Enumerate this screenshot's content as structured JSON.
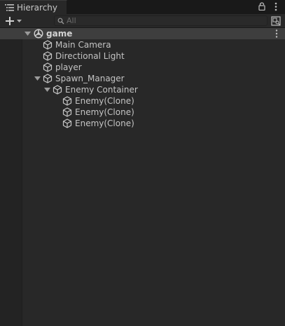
{
  "window": {
    "tab_title": "Hierarchy",
    "icons": {
      "tab": "hierarchy-list-icon",
      "lock": "lock-icon",
      "menu": "kebab-menu-icon"
    }
  },
  "toolbar": {
    "add_icon": "plus-dropdown-icon",
    "search": {
      "placeholder": "All",
      "value": ""
    },
    "scene_visibility_icon": "scene-visibility-icon"
  },
  "scene": {
    "name": "game",
    "expanded": true,
    "icon": "unity-scene-icon",
    "menu_icon": "kebab-menu-icon"
  },
  "hierarchy": [
    {
      "label": "Main Camera",
      "depth": 1,
      "has_children": false
    },
    {
      "label": "Directional Light",
      "depth": 1,
      "has_children": false
    },
    {
      "label": "player",
      "depth": 1,
      "has_children": false
    },
    {
      "label": "Spawn_Manager",
      "depth": 1,
      "has_children": true,
      "expanded": true
    },
    {
      "label": "Enemy Container",
      "depth": 2,
      "has_children": true,
      "expanded": true
    },
    {
      "label": "Enemy(Clone)",
      "depth": 3,
      "has_children": false
    },
    {
      "label": "Enemy(Clone)",
      "depth": 3,
      "has_children": false
    },
    {
      "label": "Enemy(Clone)",
      "depth": 3,
      "has_children": false
    }
  ],
  "colors": {
    "panel_bg": "#282828",
    "tab_strip": "#191919",
    "scene_row_bg": "#3e3e3e",
    "text": "#c4c4c4",
    "icon": "#bdbdbd"
  }
}
